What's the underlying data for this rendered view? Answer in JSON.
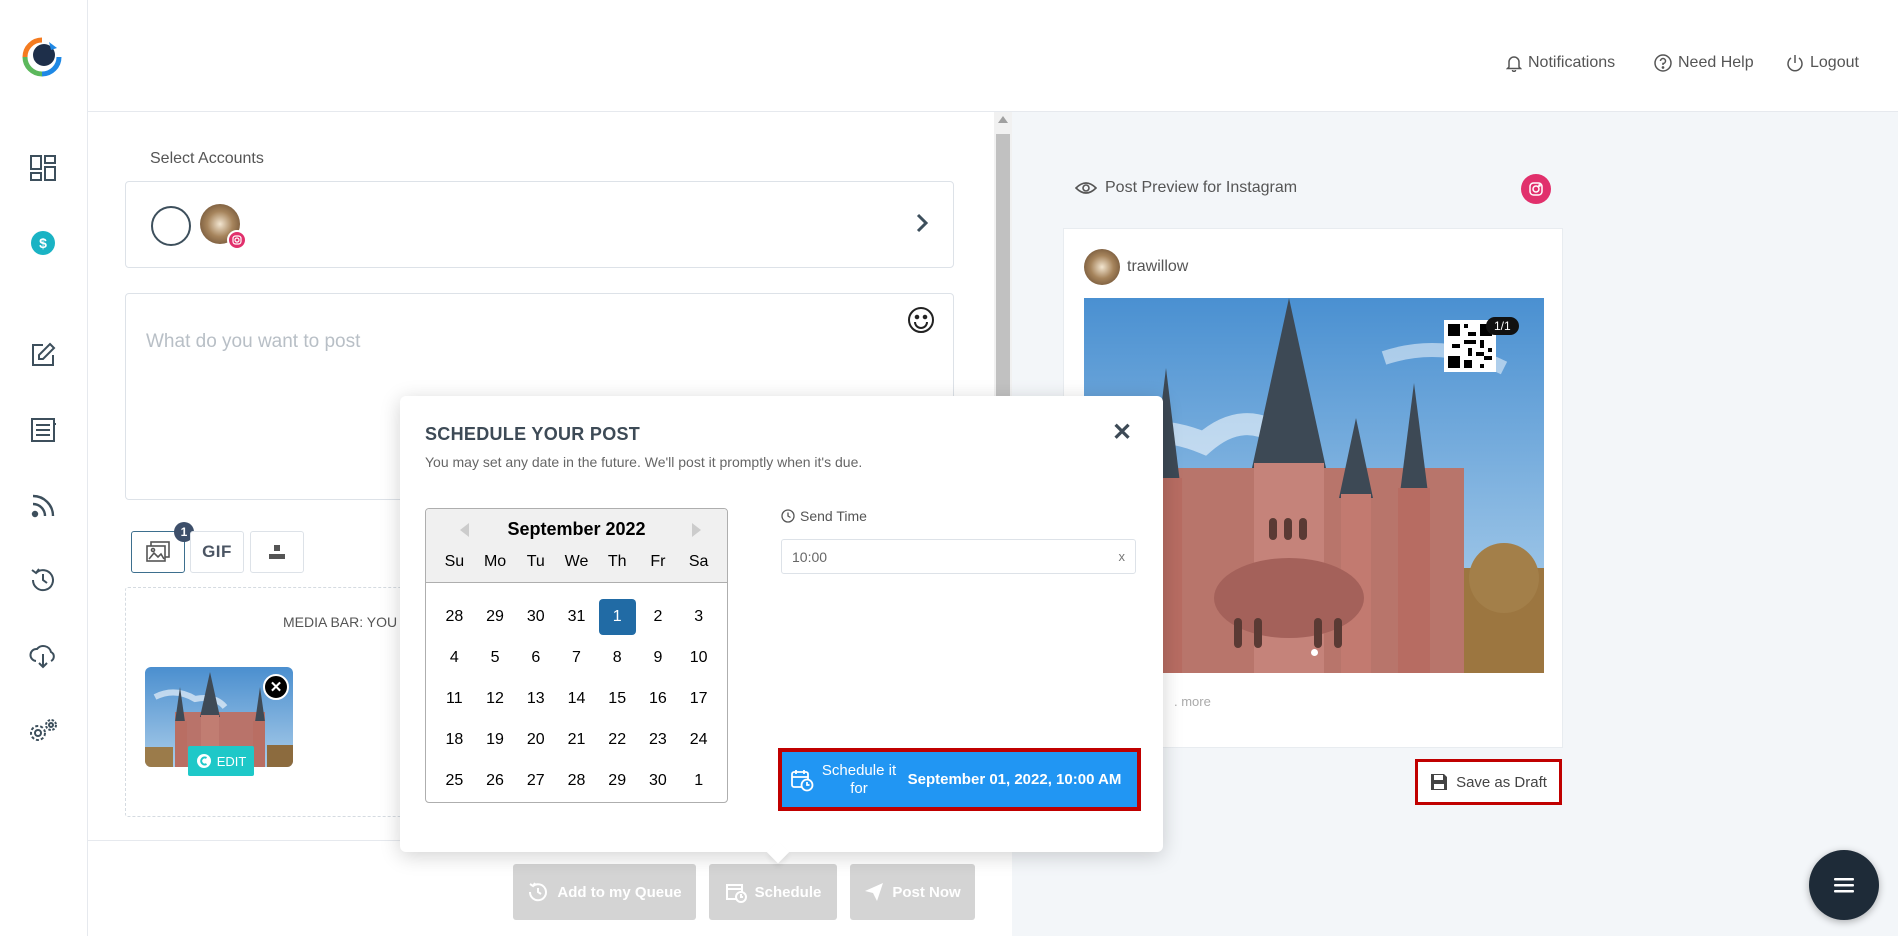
{
  "header": {
    "notifications": "Notifications",
    "need_help": "Need Help",
    "logout": "Logout"
  },
  "sidebar": {
    "items": [
      "dashboard-icon",
      "billing-icon",
      "compose-icon",
      "posts-icon",
      "rss-icon",
      "schedule-history-icon",
      "cloud-download-icon",
      "settings-icon"
    ]
  },
  "composer": {
    "select_accounts_label": "Select Accounts",
    "post_placeholder": "What do you want to post",
    "media_count": "1",
    "gif_label": "GIF",
    "media_bar_text": "MEDIA BAR: YOU",
    "edit_label": "EDIT"
  },
  "bottom_actions": {
    "queue": "Add to my Queue",
    "schedule": "Schedule",
    "post_now": "Post Now"
  },
  "modal": {
    "title": "SCHEDULE YOUR POST",
    "subtitle": "You may set any date in the future. We'll post it promptly when it's due.",
    "send_time_label": "Send Time",
    "time_value": "10:00",
    "time_clear": "x",
    "schedule_label": "Schedule it for",
    "schedule_date": "September 01, 2022, 10:00 AM"
  },
  "calendar": {
    "month_label": "September 2022",
    "dows": [
      "Su",
      "Mo",
      "Tu",
      "We",
      "Th",
      "Fr",
      "Sa"
    ],
    "days": [
      "28",
      "29",
      "30",
      "31",
      "1",
      "2",
      "3",
      "4",
      "5",
      "6",
      "7",
      "8",
      "9",
      "10",
      "11",
      "12",
      "13",
      "14",
      "15",
      "16",
      "17",
      "18",
      "19",
      "20",
      "21",
      "22",
      "23",
      "24",
      "25",
      "26",
      "27",
      "28",
      "29",
      "30",
      "1"
    ],
    "selected_index": 4
  },
  "preview": {
    "title": "Post Preview for Instagram",
    "username": "trawillow",
    "counter": "1/1",
    "more": ". more",
    "save_draft": "Save as Draft"
  },
  "colors": {
    "instagram": "#e1306c",
    "schedule_blue": "#2196f3",
    "selected_day": "#216ba5",
    "highlight_red": "#c00000"
  }
}
